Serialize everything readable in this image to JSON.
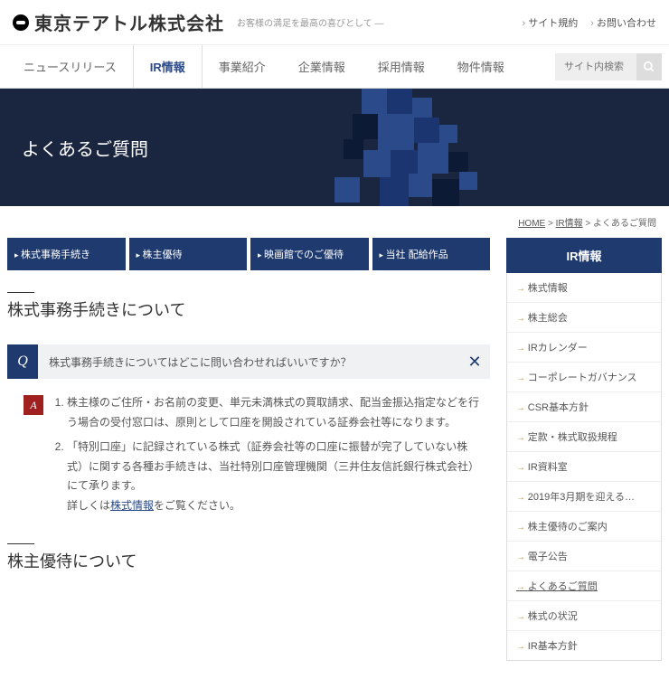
{
  "header": {
    "logo_text": "東京テアトル株式会社",
    "tagline": "お客様の満足を最高の喜びとして ―",
    "links": [
      "サイト規約",
      "お問い合わせ"
    ]
  },
  "nav": {
    "items": [
      "ニュースリリース",
      "IR情報",
      "事業紹介",
      "企業情報",
      "採用情報",
      "物件情報"
    ],
    "search_placeholder": "サイト内検索"
  },
  "hero": {
    "title": "よくあるご質問"
  },
  "breadcrumb": {
    "home": "HOME",
    "parent": "IR情報",
    "current": "よくあるご質問",
    "sep": " > "
  },
  "tabs": [
    "株式事務手続き",
    "株主優待",
    "映画館でのご優待",
    "当社 配給作品"
  ],
  "sections": [
    {
      "title": "株式事務手続きについて",
      "q": "株式事務手続きについてはどこに問い合わせればいいですか？",
      "a1": "株主様のご住所・お名前の変更、単元未満株式の買取請求、配当金振込指定などを行う場合の受付窓口は、原則として口座を開設されている証券会社等になります。",
      "a2_pre": "「特別口座」に記録されている株式（証券会社等の口座に振替が完了していない株式）に関する各種お手続きは、当社特別口座管理機関（三井住友信託銀行株式会社）にて承ります。",
      "a2_linkpre": "詳しくは",
      "a2_link": "株式情報",
      "a2_post": "をご覧ください。"
    },
    {
      "title": "株主優待について"
    }
  ],
  "sidebar": {
    "header": "IR情報",
    "items": [
      "株式情報",
      "株主総会",
      "IRカレンダー",
      "コーポレートガバナンス",
      "CSR基本方針",
      "定款・株式取扱規程",
      "IR資料室",
      "2019年3月期を迎える…",
      "株主優待のご案内",
      "電子公告",
      "よくあるご質問",
      "株式の状況",
      "IR基本方針"
    ]
  }
}
